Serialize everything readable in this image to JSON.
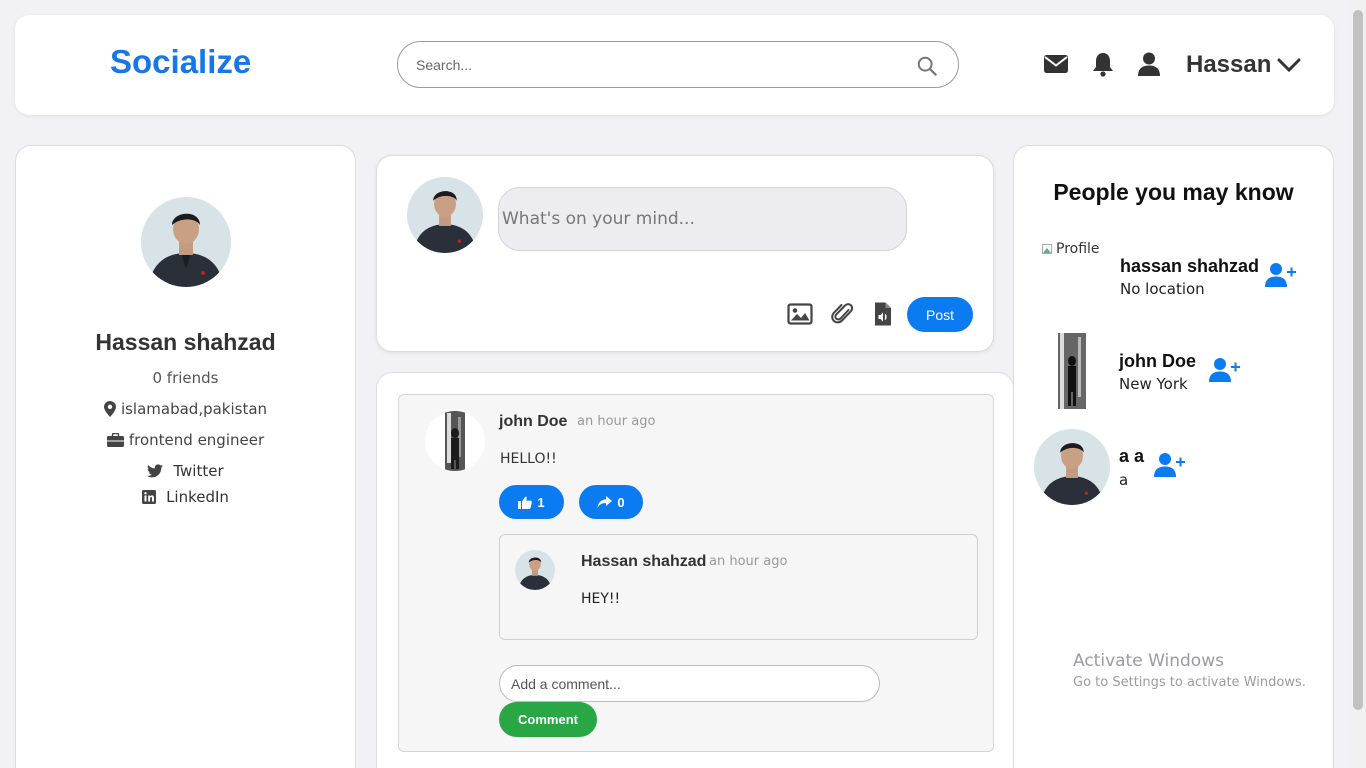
{
  "app": {
    "logo": "Socialize"
  },
  "header": {
    "search": {
      "placeholder": "Search..."
    },
    "user_name": "Hassan",
    "icons": [
      "envelope-icon",
      "bell-icon",
      "user-icon",
      "chevron-down-icon",
      "search-icon"
    ]
  },
  "profile": {
    "name": "Hassan shahzad",
    "friends": "0 friends",
    "location": "islamabad,pakistan",
    "job": "frontend engineer",
    "twitter": "Twitter",
    "linkedin": "LinkedIn"
  },
  "composer": {
    "placeholder": "What's on your mind...",
    "post_label": "Post",
    "tools": [
      "image-icon",
      "paperclip-icon",
      "audio-file-icon"
    ]
  },
  "feed": {
    "post": {
      "author": "john Doe",
      "time": "an hour ago",
      "text": "HELLO!!",
      "likes": "1",
      "shares": "0",
      "comment": {
        "author": "Hassan shahzad",
        "time": "an hour ago",
        "text": "HEY!!"
      },
      "comment_placeholder": "Add a comment...",
      "comment_button": "Comment"
    }
  },
  "suggestions": {
    "title": "People you may know",
    "people": [
      {
        "name": "hassan shahzad",
        "location": "No location",
        "alt": "Profile"
      },
      {
        "name": "john Doe",
        "location": "New York"
      },
      {
        "name": "a a",
        "location": "a"
      }
    ]
  },
  "watermark": {
    "title": "Activate Windows",
    "subtitle": "Go to Settings to activate Windows."
  },
  "colors": {
    "brand": "#1877e8",
    "primary": "#0b7bf2",
    "success": "#29a745"
  }
}
